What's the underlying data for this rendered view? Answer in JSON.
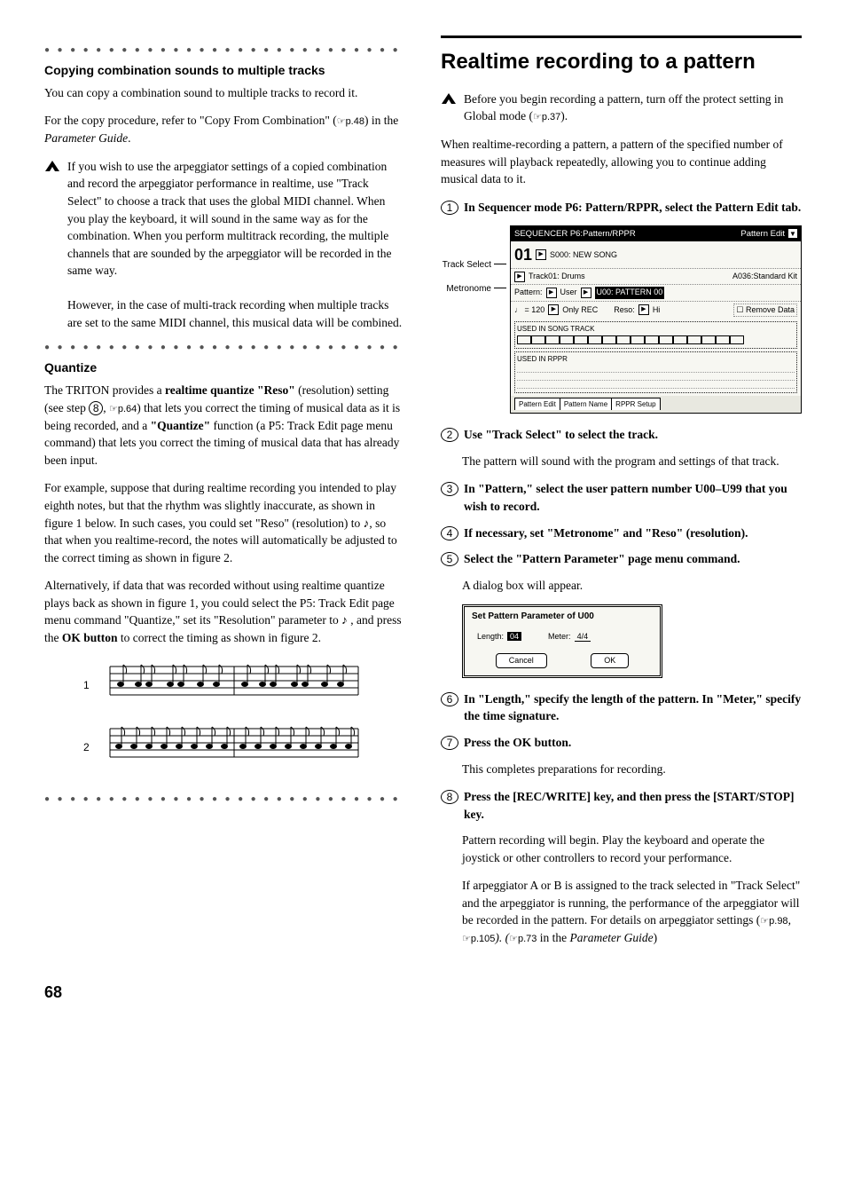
{
  "left": {
    "sec1_title": "Copying combination sounds to multiple tracks",
    "sec1_p1": "You can copy a combination sound to multiple tracks to record it.",
    "sec1_p2_a": "For the copy procedure, refer to \"Copy From Combination\" (",
    "sec1_p2_ref": "☞p.48",
    "sec1_p2_b": ") in the ",
    "sec1_p2_it": "Parameter Guide",
    "sec1_p2_c": ".",
    "sec1_note1": "If you wish to use the arpeggiator settings of a copied combination and record the arpeggiator performance in realtime, use \"Track Select\" to choose a track that uses the global MIDI channel. When you play the keyboard, it will sound in the same way as for the combination. When you perform multitrack recording, the multiple channels that are sounded by the arpeggiator will be recorded in the same way.",
    "sec1_note2": "However, in the case of multi-track recording when multiple tracks are set to the same MIDI channel, this musical data will be combined.",
    "sec2_title": "Quantize",
    "sec2_p1_a": "The TRITON provides a ",
    "sec2_p1_b": "realtime quantize \"Reso\"",
    "sec2_p1_c": " (resolution) setting (see step ",
    "sec2_p1_step": "8",
    "sec2_p1_d": ", ",
    "sec2_p1_ref": "☞p.64",
    "sec2_p1_e": ") that lets you correct the timing of musical data as it is being recorded, and a ",
    "sec2_p1_f": "\"Quantize\"",
    "sec2_p1_g": " function (a P5: Track Edit page menu command) that lets you correct the timing of musical data that has already been input.",
    "sec2_p2": "For example, suppose that during realtime recording you intended to play eighth notes, but that the rhythm was slightly inaccurate, as shown in figure 1 below. In such cases, you could set \"Reso\" (resolution) to ♪, so that when you realtime-record, the notes will automatically be adjusted to the correct timing as shown in figure 2.",
    "sec2_p3_a": "Alternatively, if data that was recorded without using realtime quantize plays back as shown in figure 1, you could select the P5: Track Edit page menu command \"Quantize,\" set its \"Resolution\" parameter to ♪ , and press the ",
    "sec2_p3_b": "OK button",
    "sec2_p3_c": " to correct the timing as shown in figure 2.",
    "fig_label_1": "1",
    "fig_label_2": "2"
  },
  "right": {
    "h2": "Realtime recording to a pattern",
    "intro_note_a": "Before you begin recording a pattern, turn off the protect setting in Global mode (",
    "intro_note_ref": "☞p.37",
    "intro_note_b": ").",
    "intro_p": "When realtime-recording a pattern, a pattern of the specified number of measures will playback repeatedly, allowing you to continue adding musical data to it.",
    "s1": "In Sequencer mode P6: Pattern/RPPR, select the Pattern Edit tab.",
    "shot": {
      "label_ts": "Track Select",
      "label_mt": "Metronome",
      "title_l": "SEQUENCER P6:Pattern/RPPR",
      "title_r": "Pattern Edit",
      "song_no": "01",
      "song_name": "S000: NEW SONG",
      "track": "Track01: Drums",
      "prog": "A036:Standard Kit",
      "pat_lbl": "Pattern:",
      "pat_bank": "User",
      "pat_sel": "U00: PATTERN 00",
      "tempo": "♩ = 120",
      "metro_icon": "☐",
      "metro": "Only REC",
      "reso_l": "Reso:",
      "reso_v": "Hi",
      "remove": "Remove Data",
      "used1": "USED IN SONG TRACK",
      "used2": "USED IN RPPR",
      "tab1": "Pattern Edit",
      "tab2": "Pattern Name",
      "tab3": "RPPR Setup"
    },
    "s2": "Use \"Track Select\" to select the track.",
    "s2_p": "The pattern will sound with the program and settings of that track.",
    "s3": "In \"Pattern,\" select the user pattern number U00–U99 that you wish to record.",
    "s4": "If necessary, set \"Metronome\" and \"Reso\" (resolution).",
    "s5": "Select the \"Pattern Parameter\" page menu command.",
    "s5_p": "A dialog box will appear.",
    "dialog": {
      "title": "Set Pattern Parameter of U00",
      "len_l": "Length:",
      "len_v": "04",
      "met_l": "Meter:",
      "met_v": "4/4",
      "cancel": "Cancel",
      "ok": "OK"
    },
    "s6": "In \"Length,\" specify the length of the pattern. In \"Meter,\" specify the time signature.",
    "s7": "Press the OK button.",
    "s7_p": "This completes preparations for recording.",
    "s8": "Press the [REC/WRITE] key, and then press the [START/STOP] key.",
    "s8_p1": "Pattern recording will begin. Play the keyboard and operate the joystick or other controllers to record your performance.",
    "s8_p2_a": "If arpeggiator A or B is assigned to the track selected in \"Track Select\" and the arpeggiator is running, the performance of the arpeggiator will be recorded in the pattern. For details on arpeggiator settings (",
    "s8_p2_r1": "☞p.98",
    "s8_p2_b": ", ",
    "s8_p2_r2": "☞p.105",
    "s8_p2_c": "). (",
    "s8_p2_r3": "☞p.73",
    "s8_p2_d": " in the ",
    "s8_p2_it": "Parameter Guide",
    "s8_p2_e": ")"
  },
  "dots": "● ● ● ● ● ● ● ● ● ● ● ● ● ● ● ● ● ● ● ● ● ● ● ● ● ● ● ● ● ●",
  "pagenum": "68"
}
